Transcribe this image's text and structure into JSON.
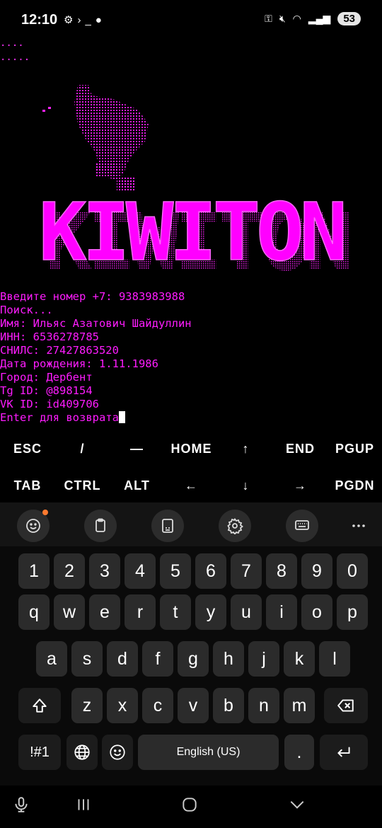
{
  "status": {
    "time": "12:10",
    "battery": "53"
  },
  "terminal": {
    "dots": [
      "....",
      "....."
    ],
    "logo_text": "KIWITON",
    "lines": [
      "Введите номер +7: 9383983988",
      "Поиск...",
      "Имя: Ильяс Азатович Шайдуллин",
      "ИНН: 6536278785",
      "СНИЛС: 27427863520",
      "Дата рождения: 1.11.1986",
      "Город: Дербент",
      "Tg ID: @898154",
      "VK ID: id409706",
      "Enter для возврата"
    ]
  },
  "extra_keys": {
    "row1": [
      "ESC",
      "/",
      "—",
      "HOME",
      "↑",
      "END",
      "PGUP"
    ],
    "row2": [
      "TAB",
      "CTRL",
      "ALT",
      "←",
      "↓",
      "→",
      "PGDN"
    ]
  },
  "keyboard": {
    "numbers": [
      "1",
      "2",
      "3",
      "4",
      "5",
      "6",
      "7",
      "8",
      "9",
      "0"
    ],
    "row1": [
      "q",
      "w",
      "e",
      "r",
      "t",
      "y",
      "u",
      "i",
      "o",
      "p"
    ],
    "row2": [
      "a",
      "s",
      "d",
      "f",
      "g",
      "h",
      "j",
      "k",
      "l"
    ],
    "row3": [
      "z",
      "x",
      "c",
      "v",
      "b",
      "n",
      "m"
    ],
    "symbols_label": "!#1",
    "space_label": "English (US)",
    "period_label": "."
  },
  "colors": {
    "terminal_text": "#ff1cff",
    "background": "#000000"
  }
}
